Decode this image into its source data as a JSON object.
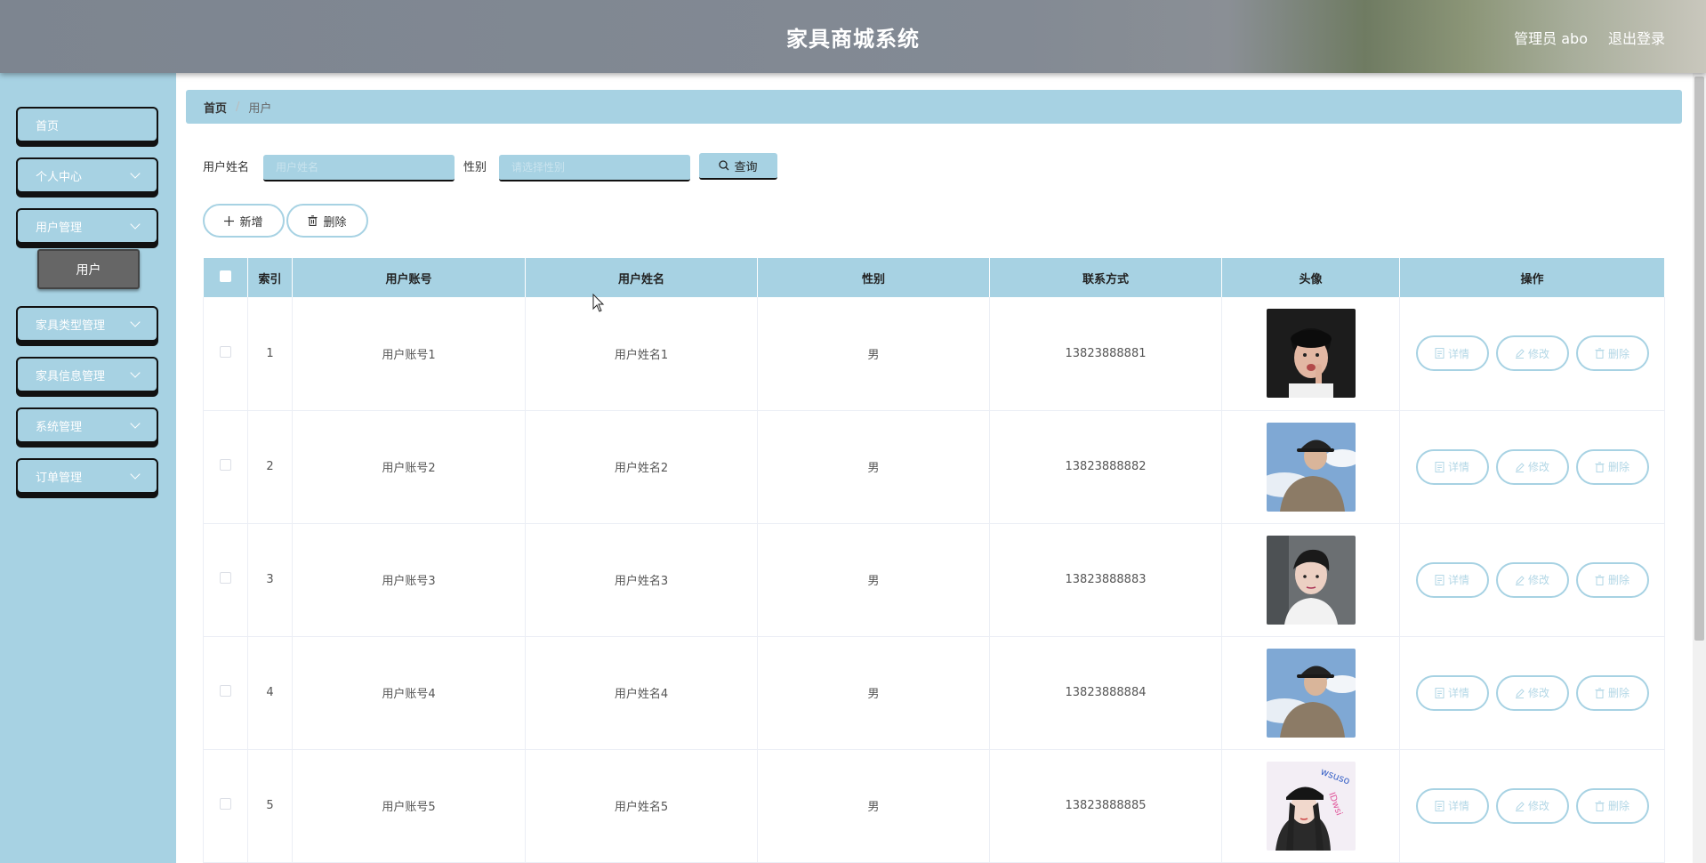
{
  "header": {
    "title": "家具商城系统",
    "user": "管理员 abo",
    "logout": "退出登录"
  },
  "sidebar": {
    "items": [
      {
        "label": "首页",
        "has_children": false
      },
      {
        "label": "个人中心",
        "has_children": true
      },
      {
        "label": "用户管理",
        "has_children": true
      },
      {
        "label": "家具类型管理",
        "has_children": true
      },
      {
        "label": "家具信息管理",
        "has_children": true
      },
      {
        "label": "系统管理",
        "has_children": true
      },
      {
        "label": "订单管理",
        "has_children": true
      }
    ],
    "active_sub": "用户"
  },
  "breadcrumb": {
    "home": "首页",
    "separator": "/",
    "current": "用户"
  },
  "search": {
    "name_label": "用户姓名",
    "name_placeholder": "用户姓名",
    "gender_label": "性别",
    "gender_placeholder": "请选择性别",
    "query_label": "查询"
  },
  "actions": {
    "add_label": "新增",
    "delete_label": "删除"
  },
  "table": {
    "columns": [
      "",
      "索引",
      "用户账号",
      "用户姓名",
      "性别",
      "联系方式",
      "头像",
      "操作"
    ],
    "rows": [
      {
        "index": "1",
        "account": "用户账号1",
        "name": "用户姓名1",
        "gender": "男",
        "phone": "13823888881",
        "avatar": "avatar-1"
      },
      {
        "index": "2",
        "account": "用户账号2",
        "name": "用户姓名2",
        "gender": "男",
        "phone": "13823888882",
        "avatar": "avatar-2"
      },
      {
        "index": "3",
        "account": "用户账号3",
        "name": "用户姓名3",
        "gender": "男",
        "phone": "13823888883",
        "avatar": "avatar-3"
      },
      {
        "index": "4",
        "account": "用户账号4",
        "name": "用户姓名4",
        "gender": "男",
        "phone": "13823888884",
        "avatar": "avatar-2"
      },
      {
        "index": "5",
        "account": "用户账号5",
        "name": "用户姓名5",
        "gender": "男",
        "phone": "13823888885",
        "avatar": "avatar-5"
      }
    ],
    "row_actions": {
      "detail": "详情",
      "edit": "修改",
      "delete": "删除"
    }
  },
  "colors": {
    "accent": "#a7d2e3",
    "header_bg": "#7d8590",
    "active_sub_bg": "#666666"
  }
}
